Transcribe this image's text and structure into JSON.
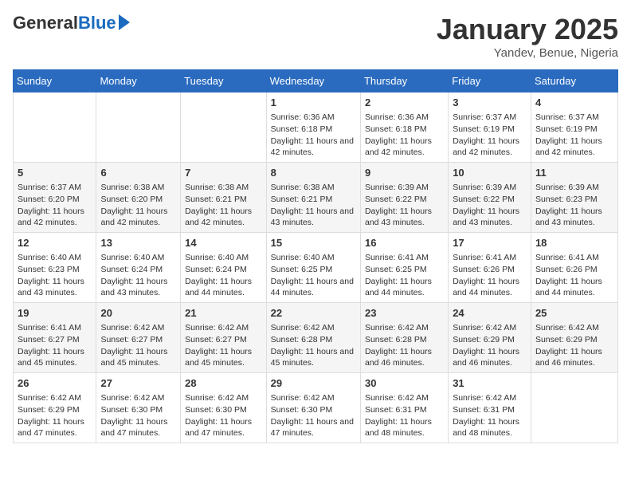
{
  "header": {
    "logo_general": "General",
    "logo_blue": "Blue",
    "month_title": "January 2025",
    "location": "Yandev, Benue, Nigeria"
  },
  "days_of_week": [
    "Sunday",
    "Monday",
    "Tuesday",
    "Wednesday",
    "Thursday",
    "Friday",
    "Saturday"
  ],
  "weeks": [
    [
      {
        "day": "",
        "info": ""
      },
      {
        "day": "",
        "info": ""
      },
      {
        "day": "",
        "info": ""
      },
      {
        "day": "1",
        "info": "Sunrise: 6:36 AM\nSunset: 6:18 PM\nDaylight: 11 hours and 42 minutes."
      },
      {
        "day": "2",
        "info": "Sunrise: 6:36 AM\nSunset: 6:18 PM\nDaylight: 11 hours and 42 minutes."
      },
      {
        "day": "3",
        "info": "Sunrise: 6:37 AM\nSunset: 6:19 PM\nDaylight: 11 hours and 42 minutes."
      },
      {
        "day": "4",
        "info": "Sunrise: 6:37 AM\nSunset: 6:19 PM\nDaylight: 11 hours and 42 minutes."
      }
    ],
    [
      {
        "day": "5",
        "info": "Sunrise: 6:37 AM\nSunset: 6:20 PM\nDaylight: 11 hours and 42 minutes."
      },
      {
        "day": "6",
        "info": "Sunrise: 6:38 AM\nSunset: 6:20 PM\nDaylight: 11 hours and 42 minutes."
      },
      {
        "day": "7",
        "info": "Sunrise: 6:38 AM\nSunset: 6:21 PM\nDaylight: 11 hours and 42 minutes."
      },
      {
        "day": "8",
        "info": "Sunrise: 6:38 AM\nSunset: 6:21 PM\nDaylight: 11 hours and 43 minutes."
      },
      {
        "day": "9",
        "info": "Sunrise: 6:39 AM\nSunset: 6:22 PM\nDaylight: 11 hours and 43 minutes."
      },
      {
        "day": "10",
        "info": "Sunrise: 6:39 AM\nSunset: 6:22 PM\nDaylight: 11 hours and 43 minutes."
      },
      {
        "day": "11",
        "info": "Sunrise: 6:39 AM\nSunset: 6:23 PM\nDaylight: 11 hours and 43 minutes."
      }
    ],
    [
      {
        "day": "12",
        "info": "Sunrise: 6:40 AM\nSunset: 6:23 PM\nDaylight: 11 hours and 43 minutes."
      },
      {
        "day": "13",
        "info": "Sunrise: 6:40 AM\nSunset: 6:24 PM\nDaylight: 11 hours and 43 minutes."
      },
      {
        "day": "14",
        "info": "Sunrise: 6:40 AM\nSunset: 6:24 PM\nDaylight: 11 hours and 44 minutes."
      },
      {
        "day": "15",
        "info": "Sunrise: 6:40 AM\nSunset: 6:25 PM\nDaylight: 11 hours and 44 minutes."
      },
      {
        "day": "16",
        "info": "Sunrise: 6:41 AM\nSunset: 6:25 PM\nDaylight: 11 hours and 44 minutes."
      },
      {
        "day": "17",
        "info": "Sunrise: 6:41 AM\nSunset: 6:26 PM\nDaylight: 11 hours and 44 minutes."
      },
      {
        "day": "18",
        "info": "Sunrise: 6:41 AM\nSunset: 6:26 PM\nDaylight: 11 hours and 44 minutes."
      }
    ],
    [
      {
        "day": "19",
        "info": "Sunrise: 6:41 AM\nSunset: 6:27 PM\nDaylight: 11 hours and 45 minutes."
      },
      {
        "day": "20",
        "info": "Sunrise: 6:42 AM\nSunset: 6:27 PM\nDaylight: 11 hours and 45 minutes."
      },
      {
        "day": "21",
        "info": "Sunrise: 6:42 AM\nSunset: 6:27 PM\nDaylight: 11 hours and 45 minutes."
      },
      {
        "day": "22",
        "info": "Sunrise: 6:42 AM\nSunset: 6:28 PM\nDaylight: 11 hours and 45 minutes."
      },
      {
        "day": "23",
        "info": "Sunrise: 6:42 AM\nSunset: 6:28 PM\nDaylight: 11 hours and 46 minutes."
      },
      {
        "day": "24",
        "info": "Sunrise: 6:42 AM\nSunset: 6:29 PM\nDaylight: 11 hours and 46 minutes."
      },
      {
        "day": "25",
        "info": "Sunrise: 6:42 AM\nSunset: 6:29 PM\nDaylight: 11 hours and 46 minutes."
      }
    ],
    [
      {
        "day": "26",
        "info": "Sunrise: 6:42 AM\nSunset: 6:29 PM\nDaylight: 11 hours and 47 minutes."
      },
      {
        "day": "27",
        "info": "Sunrise: 6:42 AM\nSunset: 6:30 PM\nDaylight: 11 hours and 47 minutes."
      },
      {
        "day": "28",
        "info": "Sunrise: 6:42 AM\nSunset: 6:30 PM\nDaylight: 11 hours and 47 minutes."
      },
      {
        "day": "29",
        "info": "Sunrise: 6:42 AM\nSunset: 6:30 PM\nDaylight: 11 hours and 47 minutes."
      },
      {
        "day": "30",
        "info": "Sunrise: 6:42 AM\nSunset: 6:31 PM\nDaylight: 11 hours and 48 minutes."
      },
      {
        "day": "31",
        "info": "Sunrise: 6:42 AM\nSunset: 6:31 PM\nDaylight: 11 hours and 48 minutes."
      },
      {
        "day": "",
        "info": ""
      }
    ]
  ]
}
